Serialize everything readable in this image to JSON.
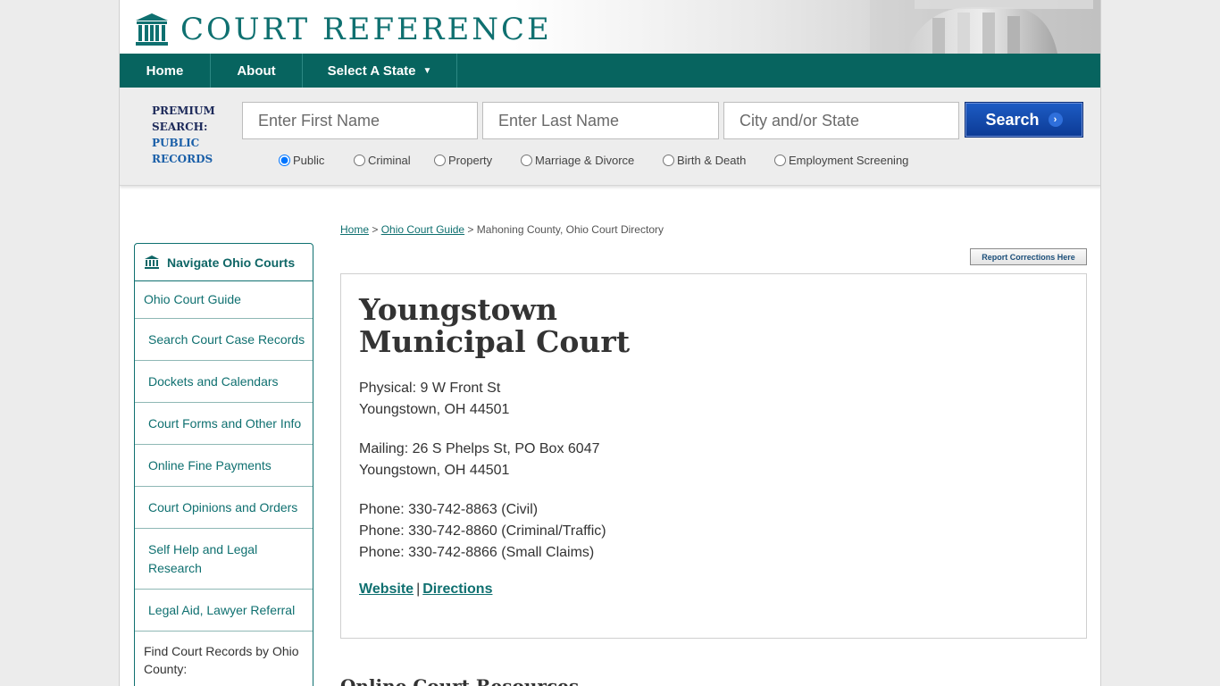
{
  "header": {
    "logo_text": "COURT REFERENCE"
  },
  "nav": {
    "home": "Home",
    "about": "About",
    "select_state": "Select A State"
  },
  "search": {
    "label_line1": "PREMIUM",
    "label_line2": "SEARCH:",
    "label_line3": "PUBLIC",
    "label_line4": "RECORDS",
    "first_name_placeholder": "Enter First Name",
    "last_name_placeholder": "Enter Last Name",
    "city_state_placeholder": "City and/or State",
    "button_label": "Search",
    "radios": [
      {
        "label": "Public",
        "checked": true
      },
      {
        "label": "Criminal",
        "checked": false
      },
      {
        "label": "Property",
        "checked": false
      },
      {
        "label": "Marriage & Divorce",
        "checked": false
      },
      {
        "label": "Birth & Death",
        "checked": false
      },
      {
        "label": "Employment Screening",
        "checked": false
      }
    ]
  },
  "sidebar": {
    "heading": "Navigate Ohio Courts",
    "guide": "Ohio Court Guide",
    "items": [
      "Search Court Case Records",
      "Dockets and Calendars",
      "Court Forms and Other Info",
      "Online Fine Payments",
      "Court Opinions and Orders",
      "Self Help and Legal Research",
      "Legal Aid, Lawyer Referral"
    ],
    "find_label": "Find Court Records by Ohio County:"
  },
  "breadcrumb": {
    "home": "Home",
    "guide": "Ohio Court Guide",
    "current": "Mahoning County, Ohio Court Directory",
    "sep": " > "
  },
  "report_button": "Report Corrections Here",
  "court": {
    "title": "Youngstown Municipal Court",
    "physical_line1": "Physical: 9 W Front St",
    "physical_line2": "Youngstown, OH 44501",
    "mailing_line1": "Mailing: 26 S Phelps St, PO Box 6047",
    "mailing_line2": "Youngstown, OH 44501",
    "phone1": "Phone: 330-742-8863 (Civil)",
    "phone2": "Phone: 330-742-8860 (Criminal/Traffic)",
    "phone3": "Phone: 330-742-8866 (Small Claims)",
    "website": "Website",
    "link_sep": "|",
    "directions": "Directions"
  },
  "section": {
    "online_resources": "Online Court Resources"
  },
  "colors": {
    "teal": "#07645f",
    "link": "#0f7070",
    "search_blue": "#0c3a94"
  }
}
